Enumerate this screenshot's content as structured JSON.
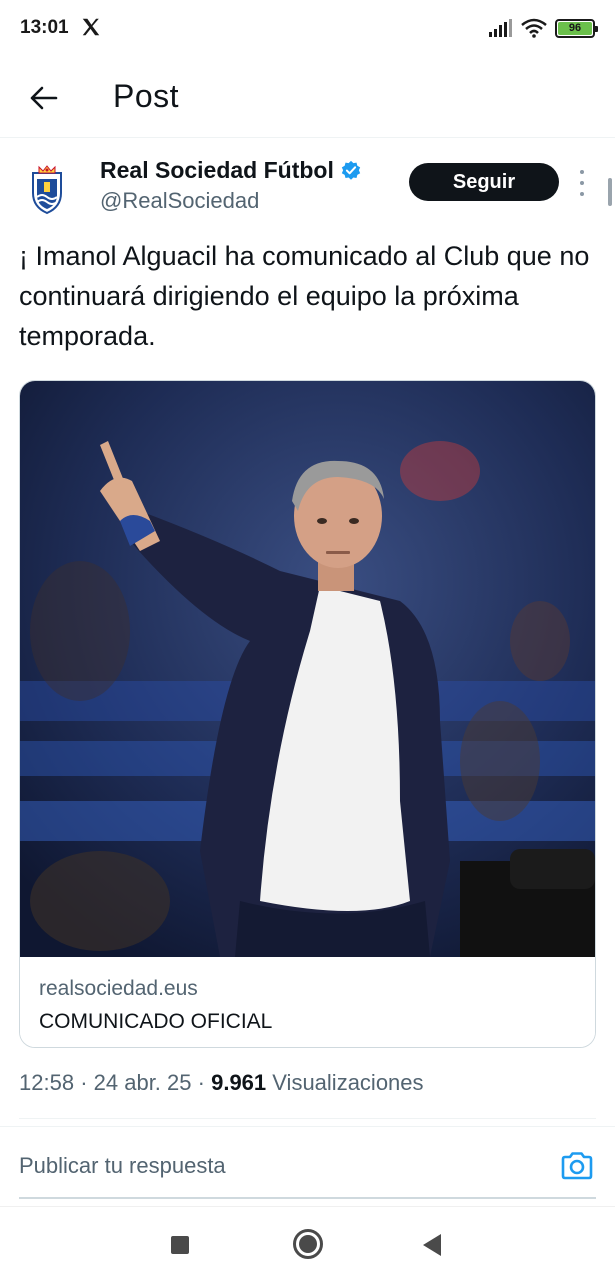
{
  "status_bar": {
    "time": "13:01",
    "battery": "96",
    "icons": [
      "x-logo-icon",
      "signal-icon",
      "wifi-icon",
      "battery-icon"
    ]
  },
  "header": {
    "back_icon": "arrow-left-icon",
    "title": "Post"
  },
  "post": {
    "author": {
      "name": "Real Sociedad Fútbol",
      "handle": "@RealSociedad",
      "verified": true
    },
    "follow_label": "Seguir",
    "text": "¡ Imanol Alguacil ha comunicado al Club que no continuará dirigiendo el equipo la próxima temporada.",
    "card": {
      "domain": "realsociedad.eus",
      "title": "COMUNICADO OFICIAL"
    },
    "time": "12:58",
    "separator": "·",
    "date": "24 abr. 25",
    "views_count": "9.961",
    "views_label": "Visualizaciones"
  },
  "reply": {
    "placeholder": "Publicar tu respuesta",
    "camera_icon": "camera-icon"
  },
  "nav": {
    "icons": [
      "recents-square-icon",
      "home-circle-icon",
      "back-triangle-icon"
    ]
  },
  "colors": {
    "accent": "#1d9bf0",
    "text_primary": "#0f1419",
    "text_secondary": "#536471",
    "battery": "#6bc04b"
  }
}
